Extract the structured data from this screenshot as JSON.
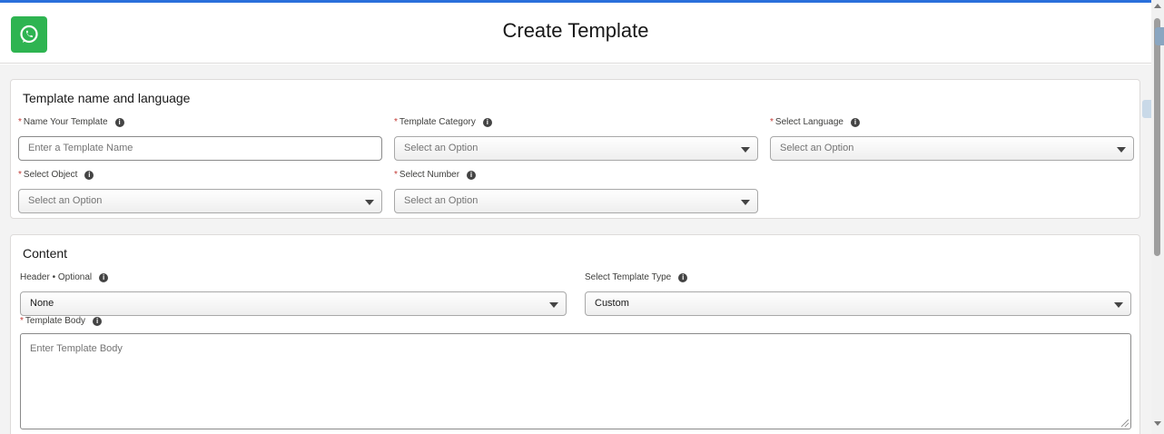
{
  "header": {
    "title": "Create Template",
    "logo_icon": "whatsapp-icon",
    "accent_color": "#2eb451"
  },
  "section1": {
    "title": "Template name and language",
    "name": {
      "label": "Name Your Template",
      "placeholder": "Enter a Template Name"
    },
    "category": {
      "label": "Template Category",
      "value": "Select an Option"
    },
    "language": {
      "label": "Select Language",
      "value": "Select an Option"
    },
    "object": {
      "label": "Select Object",
      "value": "Select an Option"
    },
    "number": {
      "label": "Select Number",
      "value": "Select an Option"
    }
  },
  "section2": {
    "title": "Content",
    "header_field": {
      "label": "Header • Optional",
      "value": "None"
    },
    "template_type": {
      "label": "Select Template Type",
      "value": "Custom"
    },
    "body": {
      "label": "Template Body",
      "placeholder": "Enter Template Body"
    }
  },
  "required_mark": "*",
  "info_mark": "i"
}
